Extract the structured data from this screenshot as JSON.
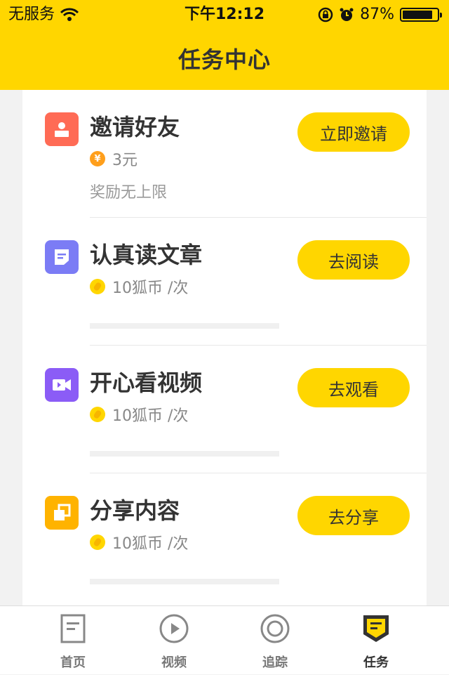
{
  "status_bar": {
    "carrier": "无服务",
    "time": "下午12:12",
    "battery": "87%",
    "battery_level": 0.87
  },
  "header": {
    "title": "任务中心"
  },
  "colors": {
    "accent": "#ffd600",
    "invite_icon": "#ff6b55",
    "read_icon": "#7b7cf5",
    "video_icon": "#8b5cf6",
    "share_icon": "#ffb300"
  },
  "tasks": [
    {
      "title": "邀请好友",
      "reward": "3元",
      "note": "奖励无上限",
      "button": "立即邀请",
      "icon": "person-icon"
    },
    {
      "title": "认真读文章",
      "reward": "10狐币 /次",
      "button": "去阅读",
      "icon": "document-icon",
      "progress": 0
    },
    {
      "title": "开心看视频",
      "reward": "10狐币 /次",
      "button": "去观看",
      "icon": "video-icon",
      "progress": 0
    },
    {
      "title": "分享内容",
      "reward": "10狐币 /次",
      "button": "去分享",
      "icon": "share-icon",
      "progress": 0
    }
  ],
  "tabs": [
    {
      "label": "首页",
      "icon": "home-icon"
    },
    {
      "label": "视频",
      "icon": "play-icon"
    },
    {
      "label": "追踪",
      "icon": "target-icon"
    },
    {
      "label": "任务",
      "icon": "task-icon",
      "active": true
    }
  ]
}
